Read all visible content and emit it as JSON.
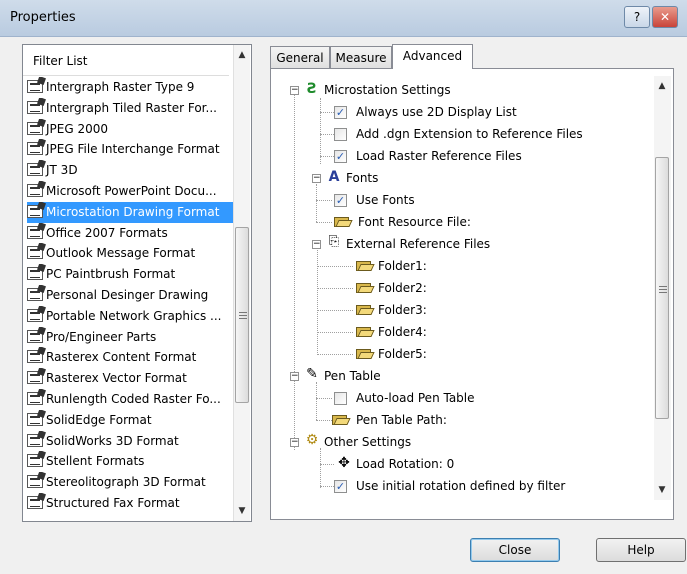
{
  "window": {
    "title": "Properties",
    "help_glyph": "?",
    "close_glyph": "✕"
  },
  "filter_panel": {
    "header": "Filter List",
    "items": [
      {
        "label": "Intergraph Raster Type 9"
      },
      {
        "label": "Intergraph Tiled Raster For..."
      },
      {
        "label": "JPEG 2000"
      },
      {
        "label": "JPEG File Interchange Format"
      },
      {
        "label": "JT 3D"
      },
      {
        "label": "Microsoft PowerPoint Docu..."
      },
      {
        "label": "Microstation Drawing Format",
        "selected": true
      },
      {
        "label": "Office 2007 Formats"
      },
      {
        "label": "Outlook Message Format"
      },
      {
        "label": "PC Paintbrush Format"
      },
      {
        "label": "Personal Desinger Drawing"
      },
      {
        "label": "Portable Network Graphics ..."
      },
      {
        "label": "Pro/Engineer Parts"
      },
      {
        "label": "Rasterex Content Format"
      },
      {
        "label": "Rasterex Vector Format"
      },
      {
        "label": "Runlength Coded Raster Fo..."
      },
      {
        "label": "SolidEdge Format"
      },
      {
        "label": "SolidWorks 3D Format"
      },
      {
        "label": "Stellent Formats"
      },
      {
        "label": "Stereolitograph 3D Format"
      },
      {
        "label": "Structured Fax Format"
      }
    ],
    "scroll_up": "▲",
    "scroll_down": "▼",
    "scroll_position": 0.62
  },
  "tabs": [
    {
      "label": "General"
    },
    {
      "label": "Measure"
    },
    {
      "label": "Advanced",
      "active": true
    }
  ],
  "tree": {
    "microstation_settings": {
      "label": "Microstation Settings",
      "always_2d": {
        "label": "Always use 2D Display List",
        "checked": true
      },
      "add_dgn": {
        "label": "Add .dgn Extension to Reference Files",
        "checked": false
      },
      "load_raster": {
        "label": "Load Raster Reference Files",
        "checked": true
      }
    },
    "fonts": {
      "label": "Fonts",
      "use_fonts": {
        "label": "Use Fonts",
        "checked": true
      },
      "font_resource": {
        "label": "Font Resource File:"
      }
    },
    "external_refs": {
      "label": "External Reference Files",
      "folders": [
        "Folder1:",
        "Folder2:",
        "Folder3:",
        "Folder4:",
        "Folder5:"
      ]
    },
    "pen_table": {
      "label": "Pen Table",
      "auto_load": {
        "label": "Auto-load Pen Table",
        "checked": false
      },
      "path": {
        "label": "Pen Table Path:"
      }
    },
    "other_settings": {
      "label": "Other Settings",
      "load_rotation": {
        "label": "Load Rotation: 0"
      },
      "use_initial_rotation": {
        "label": "Use initial rotation defined by filter",
        "checked": true
      }
    },
    "scroll_position": 0.5
  },
  "buttons": {
    "close": "Close",
    "help": "Help"
  },
  "colors": {
    "selection": "#3399ff",
    "check": "#2a5eb4"
  }
}
